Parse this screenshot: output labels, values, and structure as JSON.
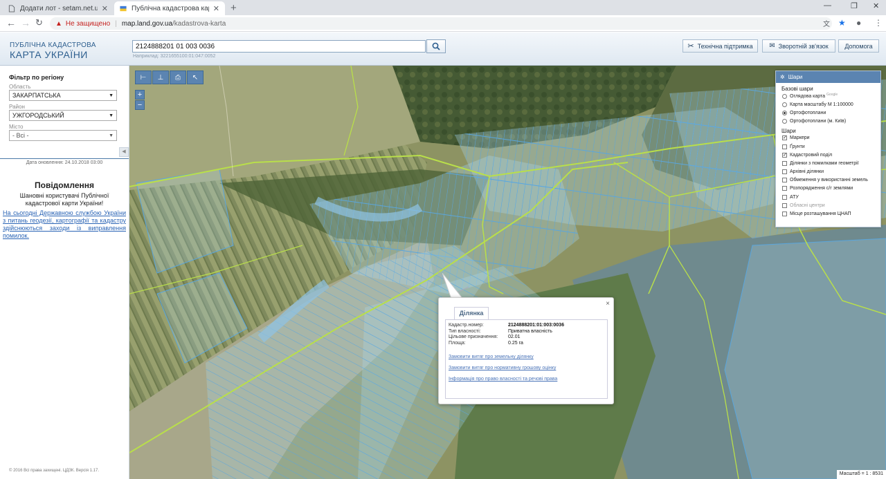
{
  "browser": {
    "tabs": [
      {
        "title": "Додати лот - setam.net.ua"
      },
      {
        "title": "Публічна кадастрова карта Укр"
      }
    ],
    "new_tab": "+",
    "controls": {
      "minimize": "—",
      "restore": "❐",
      "close": "✕"
    },
    "security_label": "Не защищено",
    "url_host": "map.land.gov.ua",
    "url_path": "/kadastrova-karta"
  },
  "header": {
    "logo_line1": "ПУБЛІЧНА КАДАСТРОВА",
    "logo_line2": "КАРТА УКРАЇНИ",
    "search_value": "2124888201 01 003 0036",
    "search_hint": "Наприклад: 3221655100:01:047:0052",
    "buttons": {
      "support": "Технічна підтримка",
      "feedback": "Зворотній зв'язок",
      "help": "Допомога"
    }
  },
  "sidebar": {
    "filter_title": "Фільтр по регіону",
    "region_label": "Область",
    "region_value": "ЗАКАРПАТСЬКА",
    "district_label": "Район",
    "district_value": "УЖГОРОДСЬКИЙ",
    "city_label": "Місто",
    "city_value": "- Всі -",
    "update_date": "Дата оновлення: 24.10.2018 03:00",
    "notice_title": "Повідомлення",
    "notice_text": "Шановні користувачі Публічної кадастрової карти України!",
    "notice_link": "На сьогодні Державною службою України з питань геодезії, картографії та кадастру здійснюються заходи із виправлення помилок.",
    "copyright": "© 2016 Всі права захищені. ЦДЗК. Версія 1.17."
  },
  "map": {
    "zoom_in": "+",
    "zoom_out": "−",
    "scale_label": "Масштаб = 1 : 8531"
  },
  "layers": {
    "title": "Шари",
    "base_title": "Базові шари",
    "base": [
      {
        "label": "Оглядова карта",
        "sup": "Google",
        "checked": false
      },
      {
        "label": "Карта масштабу М 1:100000",
        "checked": false
      },
      {
        "label": "Ортофотоплани",
        "checked": true
      },
      {
        "label": "Ортофотоплани (м. Київ)",
        "checked": false
      }
    ],
    "overlay_title": "Шари",
    "overlays": [
      {
        "label": "Маркери",
        "checked": true,
        "dim": false
      },
      {
        "label": "Ґрунти",
        "checked": false,
        "dim": false
      },
      {
        "label": "Кадастровий поділ",
        "checked": true,
        "dim": false
      },
      {
        "label": "Ділянки з помилками геометрії",
        "checked": false,
        "dim": false
      },
      {
        "label": "Архівні ділянки",
        "checked": false,
        "dim": false
      },
      {
        "label": "Обмеження у використанні земель",
        "checked": false,
        "dim": false
      },
      {
        "label": "Розпорядження с/г землями",
        "checked": false,
        "dim": false
      },
      {
        "label": "АТУ",
        "checked": false,
        "dim": false
      },
      {
        "label": "Обласні центри",
        "checked": false,
        "dim": true
      },
      {
        "label": "Місце розташування ЦНАП",
        "checked": false,
        "dim": false
      }
    ]
  },
  "popup": {
    "tab": "Ділянка",
    "close": "×",
    "rows": [
      {
        "key": "Кадастр.номер:",
        "value": "2124888201:01:003:0036",
        "bold": true
      },
      {
        "key": "Тип власності:",
        "value": "Приватна власність",
        "bold": false
      },
      {
        "key": "Цільове призначення:",
        "value": "02.01",
        "bold": false
      },
      {
        "key": "Площа:",
        "value": "0.25 га",
        "bold": false
      }
    ],
    "links": [
      "Замовити витяг про земельну ділянку",
      "Замовити витяг про нормативну грошову оцінку",
      "Інформація про право власності та речові права"
    ]
  },
  "colors": {
    "accent": "#5b84b1",
    "header_text": "#2e5f8f",
    "parcel_fill": "#a5d4f0",
    "road": "#b9df4a",
    "link": "#2a64b5"
  }
}
